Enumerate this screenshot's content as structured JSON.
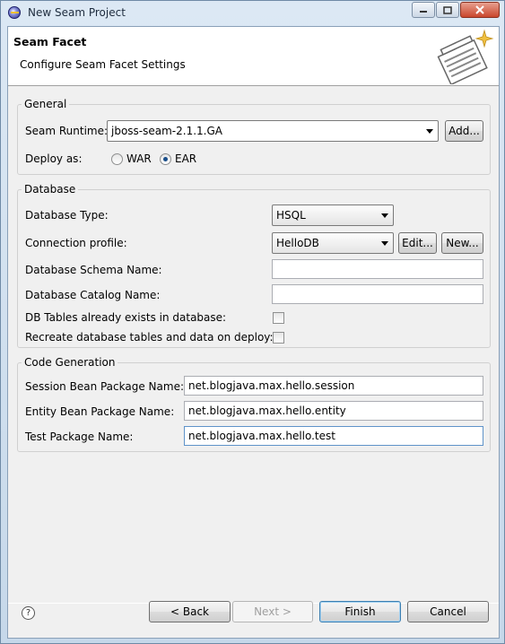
{
  "window": {
    "title": "New Seam Project"
  },
  "banner": {
    "title": "Seam Facet",
    "description": "Configure Seam Facet Settings"
  },
  "general": {
    "title": "General",
    "runtime_label": "Seam Runtime:",
    "runtime_value": "jboss-seam-2.1.1.GA",
    "add_label": "Add...",
    "deploy_label": "Deploy as:",
    "deploy_options": [
      "WAR",
      "EAR"
    ],
    "deploy_selected": "EAR"
  },
  "database": {
    "title": "Database",
    "type_label": "Database Type:",
    "type_value": "HSQL",
    "profile_label": "Connection profile:",
    "profile_value": "HelloDB",
    "edit_label": "Edit...",
    "new_label": "New...",
    "schema_label": "Database Schema Name:",
    "schema_value": "",
    "catalog_label": "Database Catalog Name:",
    "catalog_value": "",
    "tables_exist_label": "DB Tables already exists in database:",
    "tables_exist_checked": false,
    "recreate_label": "Recreate database tables and data on deploy:",
    "recreate_checked": false
  },
  "codegen": {
    "title": "Code Generation",
    "session_label": "Session Bean Package Name:",
    "session_value": "net.blogjava.max.hello.session",
    "entity_label": "Entity Bean Package Name:",
    "entity_value": "net.blogjava.max.hello.entity",
    "test_label": "Test Package Name:",
    "test_value": "net.blogjava.max.hello.test"
  },
  "footer": {
    "help_icon": "?",
    "back_label": "< Back",
    "next_label": "Next >",
    "finish_label": "Finish",
    "cancel_label": "Cancel"
  }
}
